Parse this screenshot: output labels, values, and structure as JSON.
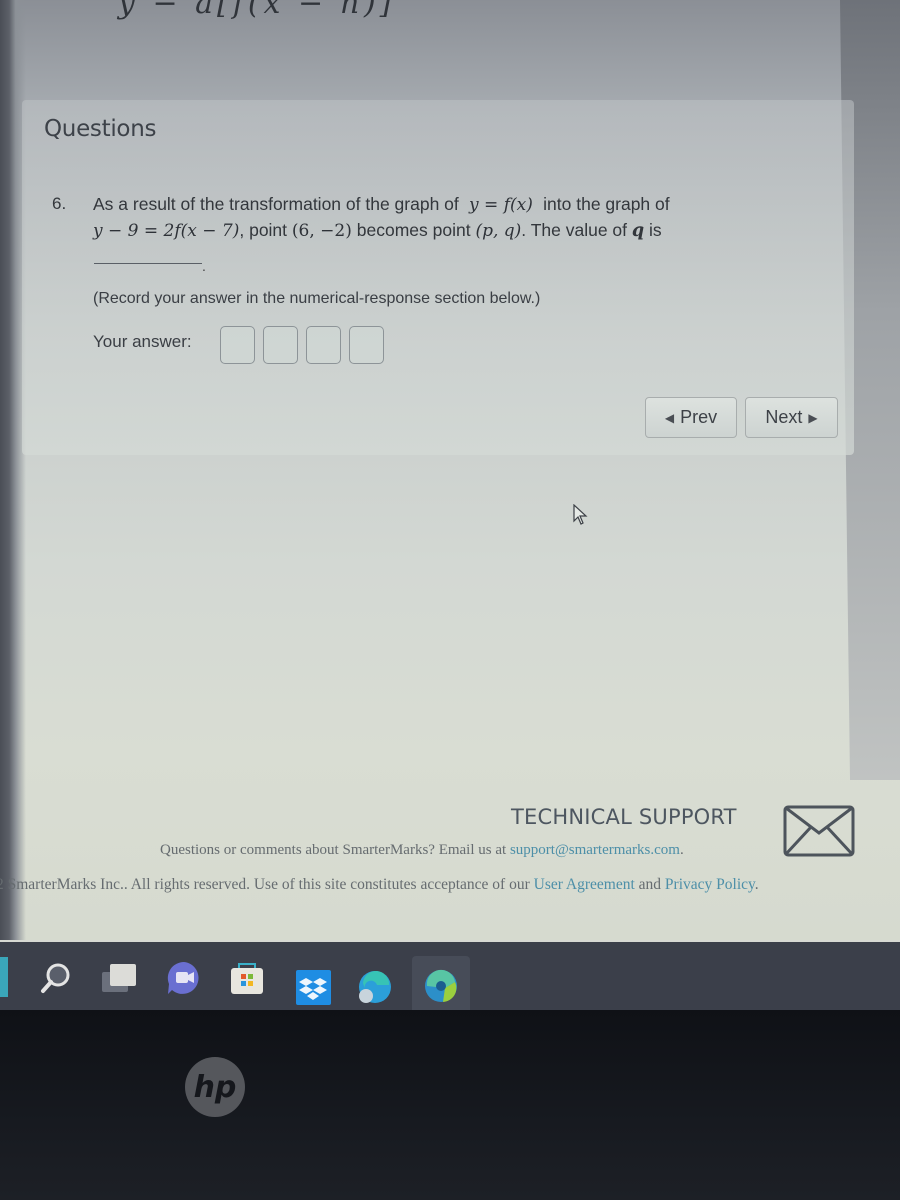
{
  "page": {
    "section_title": "Questions",
    "top_fragment": "y − a[f(x − h)]"
  },
  "question": {
    "number": "6.",
    "line1_text_a": "As a result of the transformation of the graph of",
    "line1_math": "y = f(x)",
    "line1_text_b": "into the graph of",
    "line2_math_eq": "y − 9 = 2f(x − 7)",
    "line2_text_a": ", point",
    "line2_point_a": "(6,  −2)",
    "line2_text_b": "becomes point",
    "line2_point_b": "(p, q)",
    "line2_text_c": ". The value of",
    "line2_var": "q",
    "line2_text_d": "is",
    "instruction": "(Record your answer in the numerical-response section below.)",
    "answer_label": "Your answer:",
    "answer_boxes": [
      "",
      "",
      "",
      ""
    ]
  },
  "navigation": {
    "prev_label": "Prev",
    "next_label": "Next",
    "prev_icon": "triangle-left-icon",
    "next_icon": "triangle-right-icon"
  },
  "support": {
    "title": "TECHNICAL SUPPORT",
    "text_prefix": "Questions or comments about SmarterMarks? Email us at",
    "email": "support@smartermarks.com",
    "text_suffix": "."
  },
  "footer": {
    "copyright_prefix": "2 SmarterMarks Inc.. All rights reserved. Use of this site constitutes acceptance of our",
    "user_agreement": "User Agreement",
    "and": "and",
    "privacy_policy": "Privacy Policy",
    "suffix": "."
  },
  "taskbar": {
    "items": [
      "start",
      "search",
      "task-view",
      "teams-chat",
      "microsoft-store",
      "dropbox",
      "edge",
      "edge-dev"
    ],
    "active": "edge-dev"
  },
  "device": {
    "brand": "hp"
  },
  "colors": {
    "link": "#4d8fa8",
    "taskbar": "#3b3f4a",
    "active_indicator": "#3fb2d8",
    "dropbox": "#1f8de3"
  }
}
